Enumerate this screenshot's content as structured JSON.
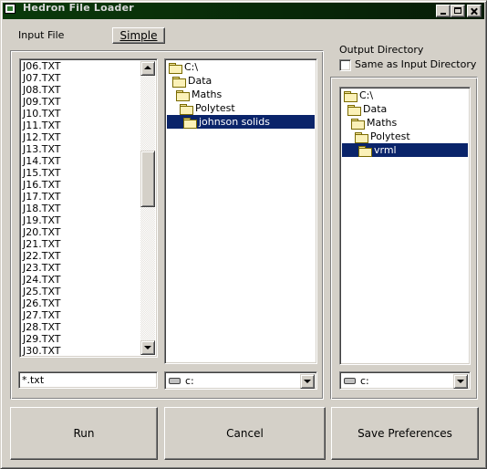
{
  "window": {
    "title": "Hedron File Loader"
  },
  "input": {
    "label": "Input File",
    "simple_button": "Simple",
    "files": [
      "J06.TXT",
      "J07.TXT",
      "J08.TXT",
      "J09.TXT",
      "J10.TXT",
      "J11.TXT",
      "J12.TXT",
      "J13.TXT",
      "J14.TXT",
      "J15.TXT",
      "J16.TXT",
      "J17.TXT",
      "J18.TXT",
      "J19.TXT",
      "J20.TXT",
      "J21.TXT",
      "J22.TXT",
      "J23.TXT",
      "J24.TXT",
      "J25.TXT",
      "J26.TXT",
      "J27.TXT",
      "J28.TXT",
      "J29.TXT",
      "J30.TXT"
    ],
    "pattern": "*.txt",
    "dirs": [
      "C:\\",
      "Data",
      "Maths",
      "Polytest",
      "johnson solids"
    ],
    "drive": "c:"
  },
  "output": {
    "label": "Output Directory",
    "same_as_input_label": "Same as Input Directory",
    "same_as_input_checked": false,
    "dirs": [
      "C:\\",
      "Data",
      "Maths",
      "Polytest",
      "vrml"
    ],
    "drive": "c:"
  },
  "buttons": {
    "run": "Run",
    "cancel": "Cancel",
    "save": "Save Preferences"
  }
}
